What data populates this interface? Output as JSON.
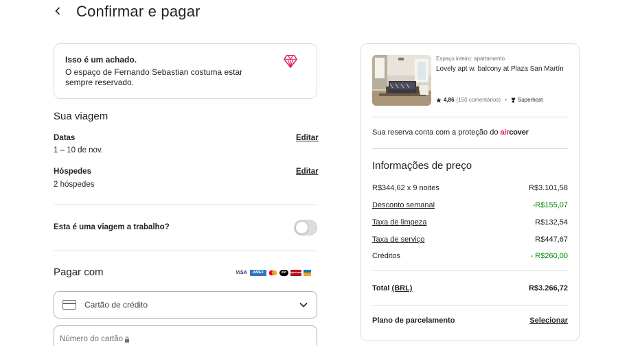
{
  "header": {
    "title": "Confirmar e pagar"
  },
  "found_card": {
    "title": "Isso é um achado.",
    "text": "O espaço de Fernando Sebastian costuma estar sempre reservado."
  },
  "trip": {
    "title": "Sua viagem",
    "dates_label": "Datas",
    "dates_value": "1 – 10 de nov.",
    "guests_label": "Hóspedes",
    "guests_value": "2 hóspedes",
    "edit_label": "Editar",
    "work_trip_label": "Esta é uma viagem a trabalho?",
    "work_trip_on": false
  },
  "payment": {
    "title": "Pagar com",
    "logos": [
      "VISA",
      "AMEX",
      "mastercard",
      "elo",
      "hipercard",
      "diners"
    ],
    "method_selected": "Cartão de crédito",
    "card_number_placeholder": "Número do cartão"
  },
  "listing": {
    "type": "Espaço inteiro: apartamento",
    "name": "Lovely apt w. balcony at Plaza San Martín",
    "rating": "4,86",
    "reviews": "(150 comentários)",
    "separator": "•",
    "badge": "Superhost"
  },
  "aircover": {
    "text": "Sua reserva conta com a proteção do",
    "logo_part1": "air",
    "logo_part2": "cover"
  },
  "price": {
    "title": "Informações de preço",
    "rows": [
      {
        "label": "R$344,62 x 9 noites",
        "value": "R$3.101,58"
      },
      {
        "label": "Desconto semanal",
        "value": "-R$155,07"
      },
      {
        "label": "Taxa de limpeza",
        "value": "R$132,54"
      },
      {
        "label": "Taxa de serviço",
        "value": "R$447,67"
      },
      {
        "label": "Créditos",
        "value": "- R$260,00"
      }
    ],
    "total_label": "Total",
    "total_currency": "(BRL)",
    "total_value": "R$3.266,72",
    "installment_label": "Plano de parcelamento",
    "installment_action": "Selecionar"
  },
  "colors": {
    "accent": "#e31c5f",
    "discount_green": "#008a05",
    "border": "#dddddd",
    "text": "#222222"
  }
}
